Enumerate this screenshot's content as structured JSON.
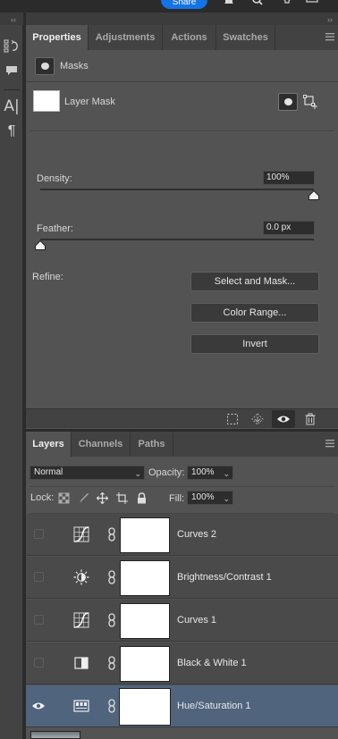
{
  "topbar": {
    "share_label": "Share"
  },
  "properties": {
    "tabs": [
      {
        "label": "Properties",
        "active": true
      },
      {
        "label": "Adjustments",
        "active": false
      },
      {
        "label": "Actions",
        "active": false
      },
      {
        "label": "Swatches",
        "active": false
      }
    ],
    "section_title": "Masks",
    "layer_mask_label": "Layer Mask",
    "density_label": "Density:",
    "density_value": "100%",
    "density_level": 1.0,
    "feather_label": "Feather:",
    "feather_value": "0.0 px",
    "feather_level": 0.0,
    "refine_label": "Refine:",
    "buttons": {
      "select_and_mask": "Select and Mask...",
      "color_range": "Color Range...",
      "invert": "Invert"
    }
  },
  "layers_panel": {
    "tabs": [
      {
        "label": "Layers",
        "active": true
      },
      {
        "label": "Channels",
        "active": false
      },
      {
        "label": "Paths",
        "active": false
      }
    ],
    "blend_mode": "Normal",
    "opacity_label": "Opacity:",
    "opacity_value": "100%",
    "lock_label": "Lock:",
    "fill_label": "Fill:",
    "fill_value": "100%",
    "layers": [
      {
        "name": "Curves 2",
        "icon": "curves-icon",
        "visible": false,
        "selected": false
      },
      {
        "name": "Brightness/Contrast 1",
        "icon": "brightness-contrast-icon",
        "visible": false,
        "selected": false
      },
      {
        "name": "Curves 1",
        "icon": "curves-icon",
        "visible": false,
        "selected": false
      },
      {
        "name": "Black & White 1",
        "icon": "black-white-icon",
        "visible": false,
        "selected": false
      },
      {
        "name": "Hue/Saturation 1",
        "icon": "hue-saturation-icon",
        "visible": true,
        "selected": true
      }
    ]
  },
  "colors": {
    "share_blue": "#1473e6",
    "selected_row": "#50647d"
  }
}
